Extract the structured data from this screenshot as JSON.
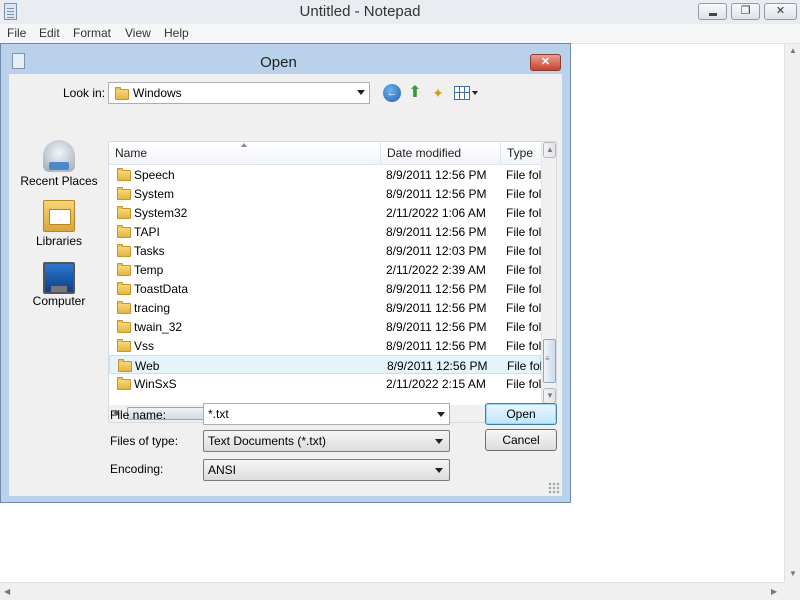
{
  "notepad": {
    "title": "Untitled - Notepad",
    "menu": [
      "File",
      "Edit",
      "Format",
      "View",
      "Help"
    ]
  },
  "dialog": {
    "title": "Open",
    "look_in_label": "Look in:",
    "look_in_value": "Windows",
    "places": [
      {
        "label": "Recent Places",
        "icon": "recent-places-icon"
      },
      {
        "label": "Libraries",
        "icon": "libraries-icon"
      },
      {
        "label": "Computer",
        "icon": "computer-icon"
      }
    ],
    "columns": {
      "name": "Name",
      "date": "Date modified",
      "type": "Type"
    },
    "files": [
      {
        "name": "Speech",
        "date": "8/9/2011 12:56 PM",
        "type": "File fol"
      },
      {
        "name": "System",
        "date": "8/9/2011 12:56 PM",
        "type": "File fol"
      },
      {
        "name": "System32",
        "date": "2/11/2022 1:06 AM",
        "type": "File fol"
      },
      {
        "name": "TAPI",
        "date": "8/9/2011 12:56 PM",
        "type": "File fol"
      },
      {
        "name": "Tasks",
        "date": "8/9/2011 12:03 PM",
        "type": "File fol"
      },
      {
        "name": "Temp",
        "date": "2/11/2022 2:39 AM",
        "type": "File fol"
      },
      {
        "name": "ToastData",
        "date": "8/9/2011 12:56 PM",
        "type": "File fol"
      },
      {
        "name": "tracing",
        "date": "8/9/2011 12:56 PM",
        "type": "File fol"
      },
      {
        "name": "twain_32",
        "date": "8/9/2011 12:56 PM",
        "type": "File fol"
      },
      {
        "name": "Vss",
        "date": "8/9/2011 12:56 PM",
        "type": "File fol"
      },
      {
        "name": "Web",
        "date": "8/9/2011 12:56 PM",
        "type": "File fol",
        "selected": true
      },
      {
        "name": "WinSxS",
        "date": "2/11/2022 2:15 AM",
        "type": "File fol"
      }
    ],
    "file_name_label": "File name:",
    "file_name_value": "*.txt",
    "files_of_type_label": "Files of type:",
    "files_of_type_value": "Text Documents (*.txt)",
    "encoding_label": "Encoding:",
    "encoding_value": "ANSI",
    "open_label": "Open",
    "cancel_label": "Cancel"
  }
}
